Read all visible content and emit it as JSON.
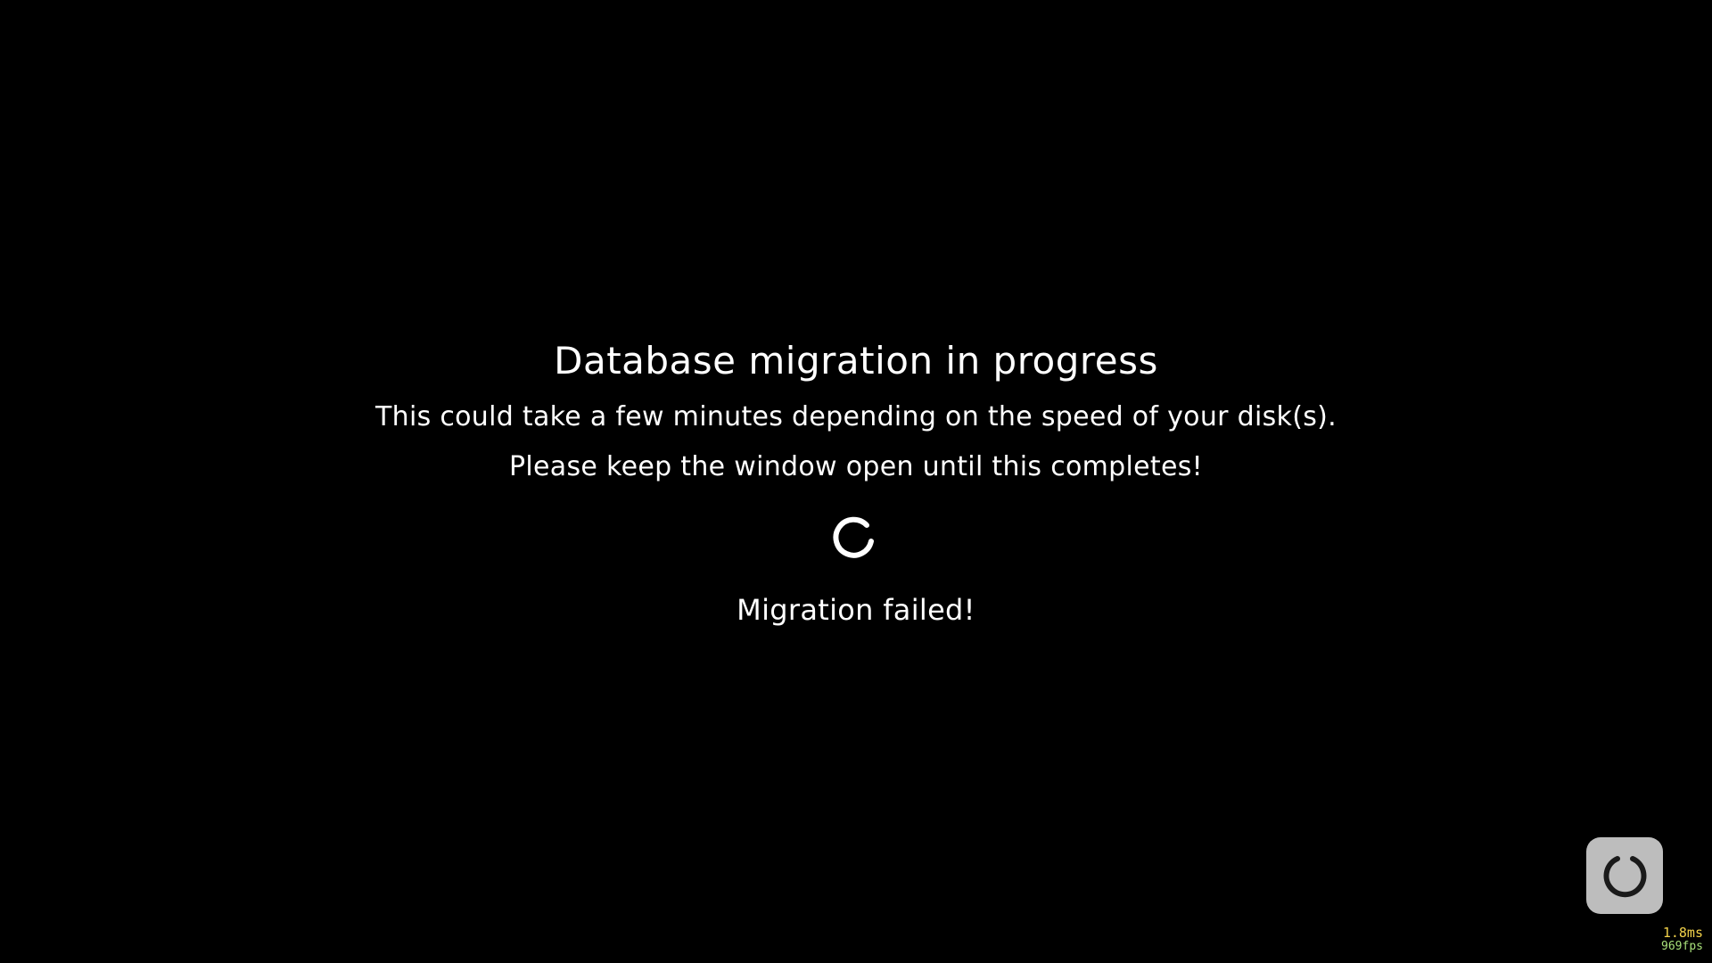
{
  "migration": {
    "title": "Database migration in progress",
    "line1": "This could take a few minutes depending on the speed of your disk(s).",
    "line2": "Please keep the window open until this completes!",
    "status": "Migration failed!",
    "spinner_icon": "loading-spinner-icon"
  },
  "corner_button": {
    "icon": "circular-arrow-icon"
  },
  "perf_overlay": {
    "frame_time": "1.8ms",
    "fps": "969fps"
  },
  "colors": {
    "background": "#000000",
    "text": "#ffffff",
    "button_bg": "#bdbdbd",
    "frame_time": "#f2d24a",
    "fps": "#a8e07a"
  }
}
